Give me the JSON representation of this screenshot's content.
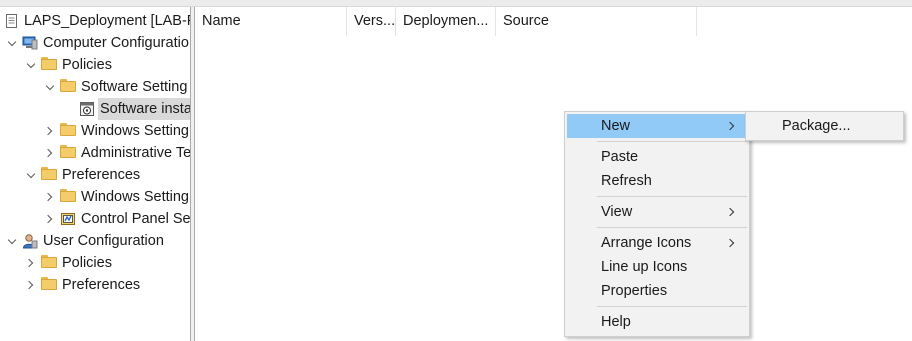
{
  "tree": {
    "items": [
      {
        "label": "LAPS_Deployment [LAB-F",
        "icon": "gpo-document-icon"
      },
      {
        "label": "Computer Configuratio",
        "icon": "computer-icon",
        "state": "expanded"
      },
      {
        "label": "Policies",
        "icon": "folder-icon",
        "state": "expanded"
      },
      {
        "label": "Software Setting",
        "icon": "folder-icon",
        "state": "expanded"
      },
      {
        "label": "Software insta",
        "icon": "software-installation-icon",
        "selected": true
      },
      {
        "label": "Windows Setting",
        "icon": "folder-icon",
        "state": "collapsed"
      },
      {
        "label": "Administrative Te",
        "icon": "folder-icon",
        "state": "collapsed"
      },
      {
        "label": "Preferences",
        "icon": "folder-icon",
        "state": "expanded"
      },
      {
        "label": "Windows Setting",
        "icon": "folder-icon",
        "state": "collapsed"
      },
      {
        "label": "Control Panel Se",
        "icon": "control-panel-icon",
        "state": "collapsed"
      },
      {
        "label": "User Configuration",
        "icon": "user-icon",
        "state": "expanded"
      },
      {
        "label": "Policies",
        "icon": "folder-icon",
        "state": "collapsed"
      },
      {
        "label": "Preferences",
        "icon": "folder-icon",
        "state": "collapsed"
      }
    ]
  },
  "list": {
    "columns": [
      "Name",
      "Vers...",
      "Deploymen...",
      "Source"
    ]
  },
  "context_menu": {
    "items": [
      {
        "label": "New",
        "has_submenu": true,
        "highlighted": true
      },
      {
        "label": "Paste"
      },
      {
        "label": "Refresh"
      },
      {
        "label": "View",
        "has_submenu": true
      },
      {
        "label": "Arrange Icons",
        "has_submenu": true
      },
      {
        "label": "Line up Icons"
      },
      {
        "label": "Properties"
      },
      {
        "label": "Help"
      }
    ]
  },
  "submenu": {
    "items": [
      {
        "label": "Package..."
      }
    ]
  },
  "colors": {
    "highlight": "#91c9f7",
    "menu_background": "#f2f2f2",
    "selection": "#d9d9d9"
  }
}
